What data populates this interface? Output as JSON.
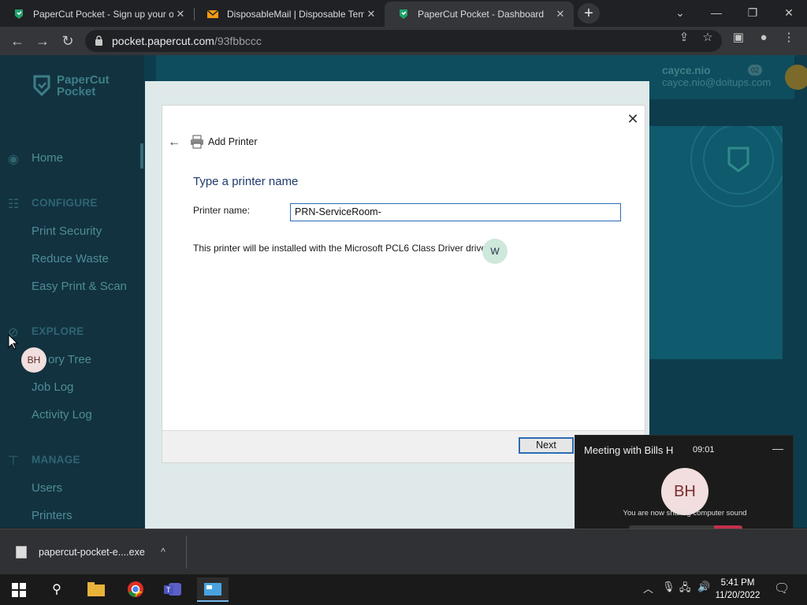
{
  "browser": {
    "tabs": [
      {
        "title": "PaperCut Pocket - Sign up your o",
        "favicon": "papercut-icon"
      },
      {
        "title": "DisposableMail | Disposable Temp",
        "favicon": "mail-icon"
      },
      {
        "title": "PaperCut Pocket - Dashboard",
        "favicon": "papercut-icon"
      }
    ],
    "new_tab": "+",
    "url_host": "pocket.papercut.com",
    "url_path": "/93fbbccc"
  },
  "app": {
    "brand_line1": "PaperCut",
    "brand_line2": "Pocket",
    "nav": {
      "home": "Home",
      "configure": "CONFIGURE",
      "print_security": "Print Security",
      "reduce_waste": "Reduce Waste",
      "easy_print": "Easy Print & Scan",
      "explore": "EXPLORE",
      "story_tree": "ory Tree",
      "job_log": "Job Log",
      "activity_log": "Activity Log",
      "manage": "MANAGE",
      "users": "Users",
      "printers": "Printers"
    },
    "user_name": "cayce.nio",
    "user_email": "cayce.nio@doitups.com",
    "notification_count": "02"
  },
  "dialog": {
    "title": "Add Printer",
    "heading": "Type a printer name",
    "label": "Printer name:",
    "printer_name_value": "PRN-ServiceRoom-",
    "info_text": "This printer will be installed with the Microsoft PCL6 Class Driver driver.",
    "next_label": "Next",
    "close": "✕",
    "back": "←"
  },
  "overlay": {
    "bubble_w": "W",
    "bubble_bh": "BH"
  },
  "meeting": {
    "title": "Meeting with Bills H",
    "timer": "09:01",
    "avatar": "BH",
    "sharing_text": "You are now sharing computer sound",
    "minimize": "—"
  },
  "download": {
    "filename": "papercut-pocket-e....exe",
    "chevron": "^"
  },
  "taskbar": {
    "time": "5:41 PM",
    "date": "11/20/2022"
  },
  "colors": {
    "sidebar": "#123240",
    "page": "#0d3c4c",
    "dialog_heading": "#1e3a6e",
    "accent_blue": "#2b6cb4",
    "end_call": "#c4314b"
  }
}
